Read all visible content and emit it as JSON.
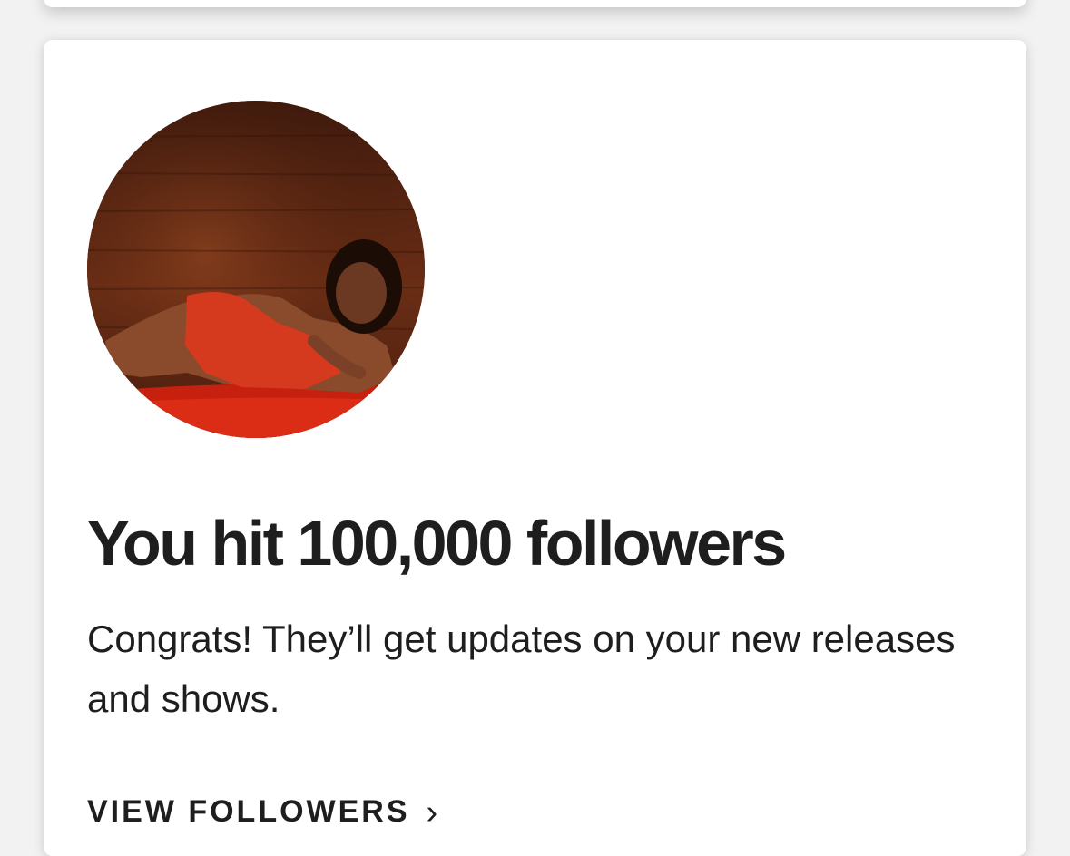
{
  "milestone": {
    "avatar_alt": "artist profile photo",
    "title": "You hit 100,000 followers",
    "message": "Congrats! They’ll get updates on your new releases and shows.",
    "cta_label": "VIEW FOLLOWERS",
    "cta_icon": "chevron-right-icon"
  },
  "colors": {
    "text": "#1e1e1e",
    "card": "#ffffff",
    "background": "#f2f2f2"
  }
}
